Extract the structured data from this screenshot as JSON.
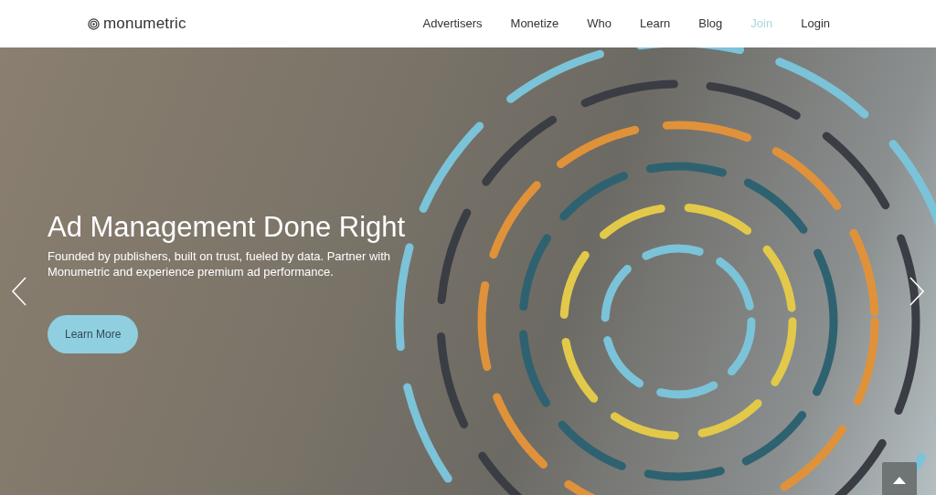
{
  "brand": {
    "name": "monumetric"
  },
  "nav": [
    {
      "label": "Advertisers",
      "kind": "link"
    },
    {
      "label": "Monetize",
      "kind": "link"
    },
    {
      "label": "Who",
      "kind": "link"
    },
    {
      "label": "Learn",
      "kind": "link"
    },
    {
      "label": "Blog",
      "kind": "link"
    },
    {
      "label": "Join",
      "kind": "accent"
    },
    {
      "label": "Login",
      "kind": "link"
    }
  ],
  "hero": {
    "title": "Ad Management Done Right",
    "subtitle": "Founded by publishers, built on trust, fueled by data. Partner with Monumetric and experience premium ad performance.",
    "button": "Learn More"
  }
}
